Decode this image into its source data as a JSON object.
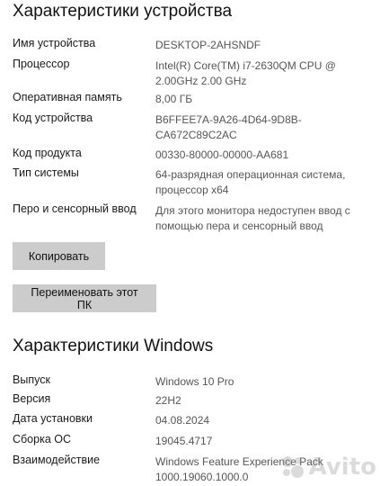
{
  "device_section": {
    "title": "Характеристики устройства",
    "rows": [
      {
        "label": "Имя устройства",
        "value": "DESKTOP-2AHSNDF"
      },
      {
        "label": "Процессор",
        "value": "Intel(R) Core(TM) i7-2630QM CPU @\n2.00GHz   2.00 GHz"
      },
      {
        "label": "Оперативная память",
        "value": "8,00 ГБ"
      },
      {
        "label": "Код устройства",
        "value": "B6FFEE7A-9A26-4D64-9D8B-\nCA672C89C2AC"
      },
      {
        "label": "Код продукта",
        "value": "00330-80000-00000-AA681"
      },
      {
        "label": "Тип системы",
        "value": "64-разрядная операционная система,\nпроцессор x64"
      },
      {
        "label": "Перо и сенсорный ввод",
        "value": "Для этого монитора недоступен ввод с\nпомощью пера и сенсорный ввод"
      }
    ],
    "copy_button": "Копировать",
    "rename_button": "Переименовать этот ПК"
  },
  "windows_section": {
    "title": "Характеристики Windows",
    "rows": [
      {
        "label": "Выпуск",
        "value": "Windows 10 Pro"
      },
      {
        "label": "Версия",
        "value": "22H2"
      },
      {
        "label": "Дата установки",
        "value": "04.08.2024"
      },
      {
        "label": "Сборка ОС",
        "value": "19045.4717"
      },
      {
        "label": "Взаимодействие",
        "value": "Windows Feature Experience Pack\n1000.19060.1000.0"
      }
    ]
  },
  "watermark": {
    "logo_icon": "avito-logo-icon",
    "text": "Avito"
  }
}
